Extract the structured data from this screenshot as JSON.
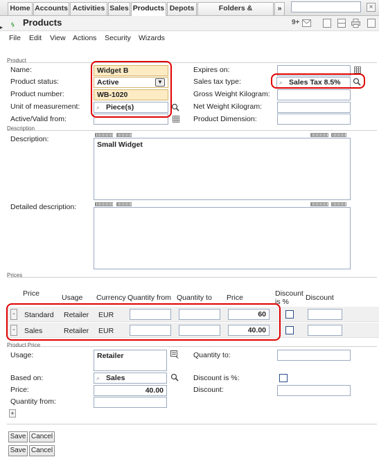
{
  "tabs": [
    {
      "label": "Home",
      "active": false
    },
    {
      "label": "Accounts",
      "active": false
    },
    {
      "label": "Activities",
      "active": false
    },
    {
      "label": "Sales",
      "active": false
    },
    {
      "label": "Products",
      "active": true
    },
    {
      "label": "Depots",
      "active": false
    },
    {
      "label": "Folders & Documents",
      "active": false
    }
  ],
  "tabs_more": "»",
  "window": {
    "title": "Products",
    "counter": "9+"
  },
  "menu": [
    "File",
    "Edit",
    "View",
    "Actions",
    "Security",
    "Wizards"
  ],
  "product": {
    "section": "Product",
    "name_label": "Name:",
    "name_value": "Widget B",
    "status_label": "Product status:",
    "status_value": "Active",
    "number_label": "Product number:",
    "number_value": "WB-1020",
    "uom_label": "Unit of measurement:",
    "uom_value": "Piece(s)",
    "active_label": "Active/Valid from:",
    "expires_label": "Expires on:",
    "tax_label": "Sales tax type:",
    "tax_value": "Sales Tax 8.5%",
    "gross_label": "Gross Weight Kilogram:",
    "net_label": "Net Weight Kilogram:",
    "dim_label": "Product Dimension:"
  },
  "description": {
    "section": "Description",
    "desc_label": "Description:",
    "desc_value": "Small Widget",
    "detail_label": "Detailed description:"
  },
  "prices": {
    "section": "Prices",
    "headers": {
      "level": "Price\nLevel",
      "usage": "Usage",
      "currency": "Currency",
      "qty_from": "Quantity from",
      "qty_to": "Quantity to",
      "price": "Price",
      "disc_pct": "Discount\nis %",
      "discount": "Discount"
    },
    "rows": [
      {
        "level": "Standard",
        "usage": "Retailer",
        "currency": "EUR",
        "price": "60"
      },
      {
        "level": "Sales",
        "usage": "Retailer",
        "currency": "EUR",
        "price": "40.00"
      }
    ]
  },
  "product_price": {
    "section": "Product Price",
    "usage_label": "Usage:",
    "usage_value": "Retailer",
    "qty_to_label": "Quantity to:",
    "based_label": "Based on:",
    "based_value": "Sales",
    "disc_pct_label": "Discount is %:",
    "price_label": "Price:",
    "price_value": "40.00",
    "discount_label": "Discount:",
    "qty_from_label": "Quantity from:"
  },
  "buttons": {
    "save": "Save",
    "cancel": "Cancel",
    "add": "+",
    "remove": "-"
  },
  "colors": {
    "required": "#fdebc4",
    "highlight": "#e00000",
    "tab_bg": "#e2e2e2"
  }
}
